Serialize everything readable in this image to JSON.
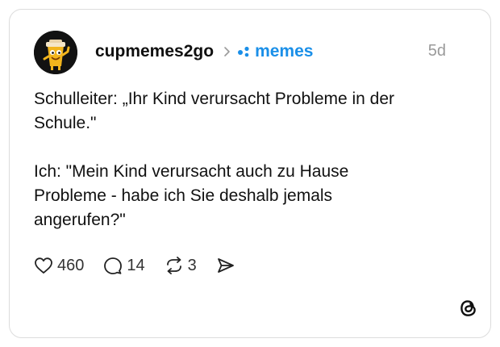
{
  "post": {
    "username": "cupmemes2go",
    "community": "memes",
    "time": "5d",
    "text_lines_1": [
      "Schulleiter: „Ihr Kind verursacht Probleme in der",
      "Schule.\""
    ],
    "text_lines_2": [
      "Ich: \"Mein Kind verursacht auch zu Hause",
      "Probleme - habe ich Sie deshalb jemals",
      "angerufen?\""
    ]
  },
  "actions": {
    "likes": "460",
    "comments": "14",
    "reposts": "3"
  },
  "icons": {
    "like": "heart-icon",
    "comment": "comment-bubble-icon",
    "repost": "repost-icon",
    "share": "send-icon",
    "brand": "threads-logo-icon",
    "separator": "chevron-right-icon",
    "community": "community-dots-icon"
  },
  "colors": {
    "community": "#1a8fe8",
    "time": "#9a9a9a",
    "avatar_bg": "#121212",
    "avatar_cup": "#f2b51d"
  }
}
